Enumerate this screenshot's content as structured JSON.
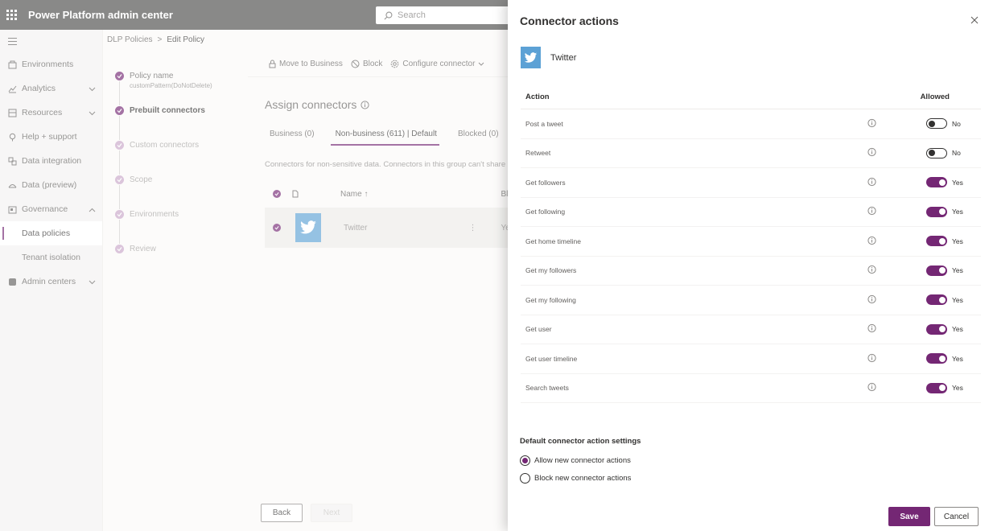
{
  "app": {
    "title": "Power Platform admin center",
    "search_placeholder": "Search"
  },
  "nav": {
    "items": [
      {
        "label": "Environments",
        "icon": "environments-icon",
        "chevron": false
      },
      {
        "label": "Analytics",
        "icon": "analytics-icon",
        "chevron": true
      },
      {
        "label": "Resources",
        "icon": "resources-icon",
        "chevron": true
      },
      {
        "label": "Help + support",
        "icon": "help-icon",
        "chevron": false
      },
      {
        "label": "Data integration",
        "icon": "data-integration-icon",
        "chevron": false
      },
      {
        "label": "Data (preview)",
        "icon": "data-preview-icon",
        "chevron": false
      },
      {
        "label": "Governance",
        "icon": "governance-icon",
        "chevron": true
      },
      {
        "label": "Data policies",
        "sub": true,
        "active": true
      },
      {
        "label": "Tenant isolation",
        "sub": true
      },
      {
        "label": "Admin centers",
        "icon": "admin-centers-icon",
        "chevron": true
      }
    ]
  },
  "breadcrumb": {
    "parent": "DLP Policies",
    "separator": ">",
    "current": "Edit Policy"
  },
  "steps": [
    {
      "title": "Policy name",
      "sub": "customPattern(DoNotDelete)"
    },
    {
      "title": "Prebuilt connectors",
      "bold": true
    },
    {
      "title": "Custom connectors"
    },
    {
      "title": "Scope"
    },
    {
      "title": "Environments"
    },
    {
      "title": "Review"
    }
  ],
  "commands": {
    "move": "Move to Business",
    "block": "Block",
    "configure": "Configure connector"
  },
  "assign": {
    "title": "Assign connectors",
    "tabs": [
      "Business (0)",
      "Non-business (611) | Default",
      "Blocked (0)"
    ],
    "description": "Connectors for non-sensitive data. Connectors in this group can't share data",
    "col_name": "Name ↑",
    "col_blocked": "Blo",
    "row_name": "Twitter",
    "row_blocked": "Yes"
  },
  "footer": {
    "back": "Back",
    "next": "Next"
  },
  "panel": {
    "title": "Connector actions",
    "connector": "Twitter",
    "col_action": "Action",
    "col_allowed": "Allowed",
    "actions": [
      {
        "name": "Post a tweet",
        "allowed": false,
        "label": "No"
      },
      {
        "name": "Retweet",
        "allowed": false,
        "label": "No"
      },
      {
        "name": "Get followers",
        "allowed": true,
        "label": "Yes"
      },
      {
        "name": "Get following",
        "allowed": true,
        "label": "Yes"
      },
      {
        "name": "Get home timeline",
        "allowed": true,
        "label": "Yes"
      },
      {
        "name": "Get my followers",
        "allowed": true,
        "label": "Yes"
      },
      {
        "name": "Get my following",
        "allowed": true,
        "label": "Yes"
      },
      {
        "name": "Get user",
        "allowed": true,
        "label": "Yes"
      },
      {
        "name": "Get user timeline",
        "allowed": true,
        "label": "Yes"
      },
      {
        "name": "Search tweets",
        "allowed": true,
        "label": "Yes"
      }
    ],
    "settings_title": "Default connector action settings",
    "radio_allow": "Allow new connector actions",
    "radio_block": "Block new connector actions",
    "save": "Save",
    "cancel": "Cancel"
  },
  "colors": {
    "accent": "#742774",
    "topbar": "#4b4a49",
    "twitter": "#5ca1d5"
  }
}
